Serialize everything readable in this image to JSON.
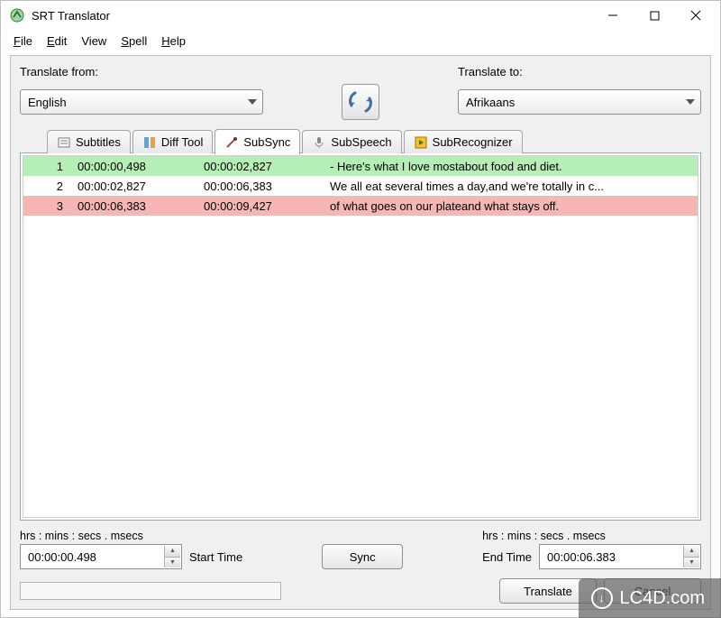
{
  "window": {
    "title": "SRT Translator",
    "min_tip": "Minimize",
    "max_tip": "Maximize",
    "close_tip": "Close"
  },
  "menubar": {
    "file": "File",
    "edit": "Edit",
    "view": "View",
    "spell": "Spell",
    "help": "Help"
  },
  "translate_panel": {
    "from_label": "Translate from:",
    "to_label": "Translate to:",
    "from_value": "English",
    "to_value": "Afrikaans",
    "swap_tip": "Swap Languages"
  },
  "tabs": {
    "subtitles": "Subtitles",
    "diff_tool": "Diff Tool",
    "subsync": "SubSync",
    "subspeech": "SubSpeech",
    "subrecognizer": "SubRecognizer",
    "active": "subsync"
  },
  "subs": [
    {
      "idx": "1",
      "start": "00:00:00,498",
      "end": "00:00:02,827",
      "text": "- Here's what I love mostabout food and diet.",
      "color": "green"
    },
    {
      "idx": "2",
      "start": "00:00:02,827",
      "end": "00:00:06,383",
      "text": "We all eat several times a day,and we're totally in c...",
      "color": "white"
    },
    {
      "idx": "3",
      "start": "00:00:06,383",
      "end": "00:00:09,427",
      "text": "of what goes on our plateand what stays off.",
      "color": "red"
    }
  ],
  "time_controls": {
    "format_label": "hrs : mins : secs . msecs",
    "start_label": "Start Time",
    "end_label": "End Time",
    "start_value": "00:00:00.498",
    "end_value": "00:00:06.383",
    "sync_label": "Sync"
  },
  "bottom": {
    "translate": "Translate",
    "cancel": "Cancel"
  },
  "watermark": {
    "text": "LC4D.com"
  }
}
